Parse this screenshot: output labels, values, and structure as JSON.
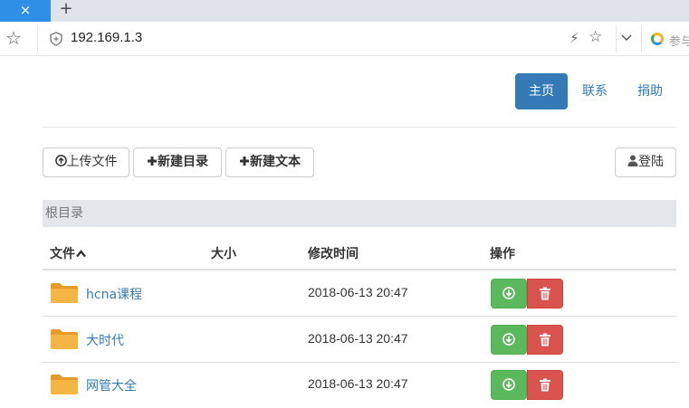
{
  "browser": {
    "tab_close_glyph": "×",
    "new_tab_glyph": "+",
    "url": "192.169.1.3",
    "extension_label": "参与"
  },
  "nav": {
    "home": "主页",
    "contact": "联系",
    "donate": "捐助"
  },
  "toolbar": {
    "upload": "上传文件",
    "new_dir": "新建目录",
    "new_text": "新建文本",
    "login": "登陆"
  },
  "breadcrumb": "根目录",
  "table": {
    "headers": {
      "name": "文件",
      "size": "大小",
      "modified": "修改时间",
      "ops": "操作"
    },
    "rows": [
      {
        "name": "hcna课程",
        "size": "",
        "modified": "2018-06-13 20:47"
      },
      {
        "name": "大时代",
        "size": "",
        "modified": "2018-06-13 20:47"
      },
      {
        "name": "网管大全",
        "size": "",
        "modified": "2018-06-13 20:47"
      }
    ]
  },
  "colors": {
    "primary": "#337ab7",
    "success": "#5cb85c",
    "danger": "#d9534f",
    "folder": "#f0ad3a",
    "browser_tab_active": "#2f8ee6"
  },
  "icons": {
    "sort": "sort-asc-icon",
    "upload": "upload-circle-icon",
    "plus": "plus-icon",
    "user": "user-icon",
    "download": "download-circle-icon",
    "delete": "trash-icon",
    "folder": "folder-icon"
  }
}
